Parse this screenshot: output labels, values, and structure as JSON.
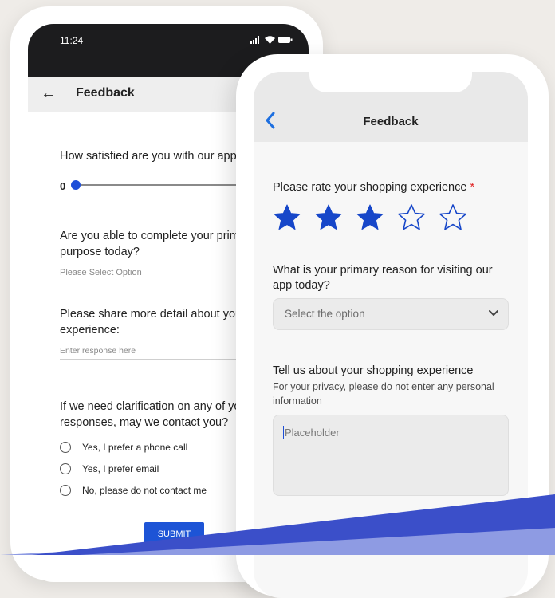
{
  "android": {
    "status_time": "11:24",
    "title": "Feedback",
    "q_satisfied": "How satisfied are you with our app?",
    "slider_value": "0",
    "q_complete": "Are you able to complete your primary purpose today?",
    "select_placeholder": "Please Select Option",
    "q_detail": "Please share more detail about your experience:",
    "response_placeholder": "Enter response here",
    "q_contact": "If we need clarification on any of your responses, may we contact you?",
    "contact_options": [
      "Yes, I prefer a phone call",
      "Yes, I prefer email",
      "No, please do not contact me"
    ],
    "submit_label": "SUBMIT"
  },
  "ios": {
    "title": "Feedback",
    "rate_label": "Please rate your shopping experience",
    "required_marker": "*",
    "rating": 3,
    "rating_max": 5,
    "reason_label": "What is your primary reason for visiting our app today?",
    "select_placeholder": "Select the option",
    "tell_label": "Tell us about your shopping experience",
    "privacy_help": "For your privacy, please do not enter any personal information",
    "textarea_placeholder": "Placeholder"
  },
  "colors": {
    "accent": "#1d4ed8",
    "star": "#1747c9",
    "band_dark": "#3b4fc9",
    "band_light": "#8e9be3"
  }
}
